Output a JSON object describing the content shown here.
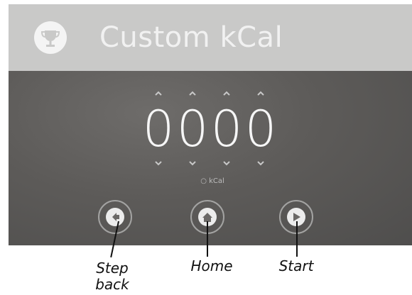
{
  "header": {
    "title": "Custom kCal",
    "icon": "trophy-icon"
  },
  "display": {
    "digits": [
      "0",
      "0",
      "0",
      "0"
    ],
    "unit": "kCal"
  },
  "buttons": [
    {
      "icon": "step-back-icon"
    },
    {
      "icon": "home-icon"
    },
    {
      "icon": "start-icon"
    }
  ],
  "callouts": {
    "step_back": "Step\nback",
    "home": "Home",
    "start": "Start"
  },
  "colors": {
    "panel": "#5d5b59",
    "header": "#c9c9c8",
    "text": "#f6f6f6"
  }
}
